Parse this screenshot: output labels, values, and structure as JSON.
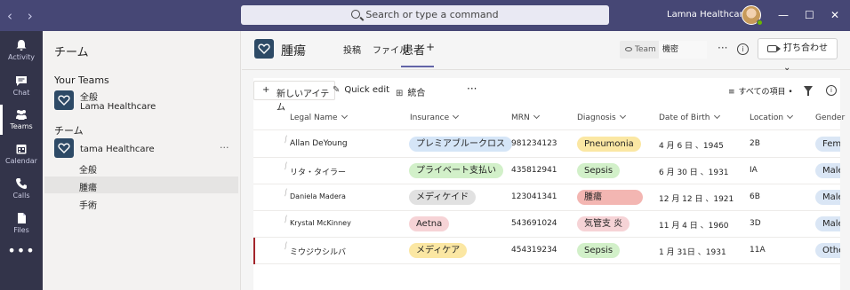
{
  "titlebar": {
    "back_glyph": "‹",
    "forward_glyph": "›",
    "search_placeholder": "Search or type a command",
    "org_name": "Lamna Healthcare ⌄",
    "minimize": "—",
    "maximize": "☐",
    "close": "✕"
  },
  "rail": {
    "items": [
      {
        "label": "Activity",
        "icon": "bell-icon"
      },
      {
        "label": "Chat",
        "icon": "chat-icon"
      },
      {
        "label": "Teams",
        "icon": "teams-icon",
        "active": true
      },
      {
        "label": "Calendar",
        "icon": "calendar-icon"
      },
      {
        "label": "Calls",
        "icon": "phone-icon"
      },
      {
        "label": "Files",
        "icon": "file-icon"
      }
    ],
    "more": "•••"
  },
  "leftpane": {
    "title": "チーム",
    "your_teams_label": "Your Teams",
    "team1": {
      "name": "全般",
      "subtitle": "Lama Healthcare"
    },
    "section2_label": "チーム",
    "team2": {
      "name": "tama Healthcare",
      "more": "···"
    },
    "channels": [
      "全般",
      "腫瘍",
      "手術"
    ]
  },
  "header": {
    "title": "腫瘍",
    "tabs": [
      "投稿",
      "ファイル",
      "患者",
      "+"
    ],
    "team_label": "Team",
    "team_value": "機密",
    "more": "···",
    "info": "i",
    "meet_label": "打ち合わせ ⌄"
  },
  "commandbar": {
    "new_item": "新しいアイテム",
    "quick_edit": "Quick edit",
    "grid_view": "統合",
    "more": "···",
    "all_items": "すべての項目 •",
    "info": "i"
  },
  "table": {
    "columns": [
      "Legal Name",
      "Insurance",
      "MRN",
      "Diagnosis",
      "Date of Birth",
      "Location",
      "Gender"
    ],
    "rows": [
      {
        "name": "Allan DeYoung",
        "insurance": "プレミアブルークロス",
        "mrn": "981234123",
        "diagnosis": "Pneumonia",
        "dob": "4 月 6 日 、1945",
        "location": "2B",
        "gender": "Fema"
      },
      {
        "name": "リタ・タイラー",
        "insurance": "プライベート支払い",
        "mrn": "435812941",
        "diagnosis": "Sepsis",
        "dob": "6 月 30 日 、1931",
        "location": "IA",
        "gender": "Male"
      },
      {
        "name": "Daniela Madera",
        "insurance": "メディケイド",
        "mrn": "123041341",
        "diagnosis": "腫瘍",
        "dob": "12 月 12 日 、1921",
        "location": "6B",
        "gender": "Male"
      },
      {
        "name": "Krystal McKinney",
        "insurance": "Aetna",
        "mrn": "543691024",
        "diagnosis": "気管支 炎",
        "dob": "11 月 4 日 、1960",
        "location": "3D",
        "gender": "Male"
      },
      {
        "name": "ミウジウシルバ",
        "insurance": "メディケア",
        "mrn": "454319234",
        "diagnosis": "Sepsis",
        "dob": "1 月 31日 、1931",
        "location": "11A",
        "gender": "Othe"
      }
    ],
    "pill_colors": {
      "blue": "#d5e5f7",
      "green": "#d2f0c9",
      "gray": "#e1e1e1",
      "pink": "#f6d3d6",
      "yellow": "#fbe7a3",
      "red": "#f3b6b2",
      "gender": "#dae6f5"
    }
  }
}
